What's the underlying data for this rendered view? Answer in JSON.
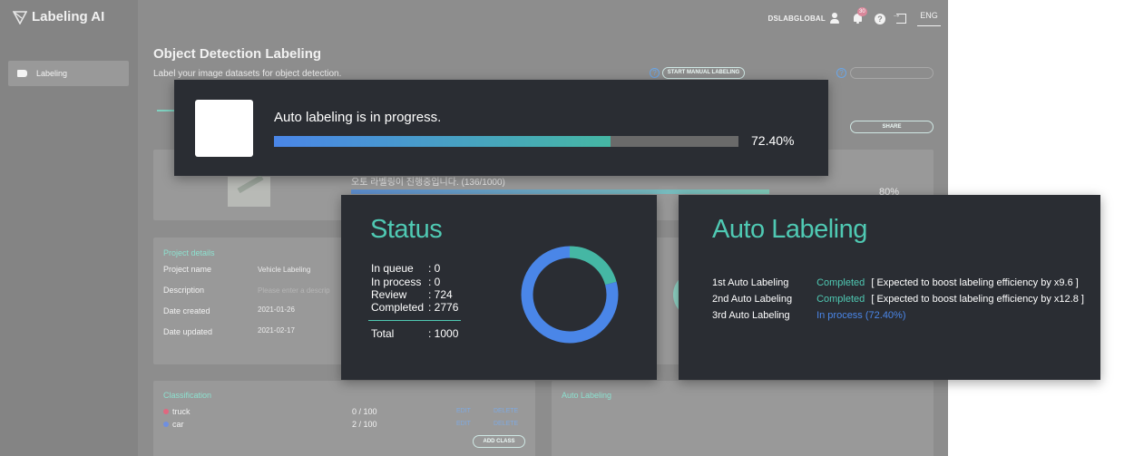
{
  "app": {
    "logo_text": "Labeling AI",
    "sidebar": {
      "items": [
        {
          "label": "Labeling",
          "icon": "tag-icon",
          "active": true
        }
      ]
    },
    "topbar": {
      "user": "DSLABGLOBAL",
      "notification_count": "30",
      "language": "ENG"
    }
  },
  "page": {
    "title": "Object Detection Labeling",
    "subtitle": "Label your image datasets for object detection.",
    "start_manual_label": "START MANUAL LABELING",
    "share_label": "SHARE",
    "bg_progress_text": "오토 라벨링이 진행중입니다. (136/1000)",
    "bg_progress_pct": "80%",
    "details": {
      "title": "Project details",
      "rows": [
        {
          "label": "Project name",
          "value": "Vehicle Labeling"
        },
        {
          "label": "Description",
          "value": "Please enter a descrip"
        },
        {
          "label": "Date created",
          "value": "2021-01-26"
        },
        {
          "label": "Date updated",
          "value": "2021-02-17"
        }
      ]
    },
    "classification": {
      "title": "Classification",
      "classes": [
        {
          "name": "truck",
          "count": "0 / 100",
          "color": "#e0677f"
        },
        {
          "name": "car",
          "count": "2 / 100",
          "color": "#6f8fe0"
        }
      ],
      "edit_label": "EDIT",
      "delete_label": "DELETE",
      "add_class_label": "ADD CLASS"
    },
    "auto_labeling_section_title": "Auto Labeling"
  },
  "progress_overlay": {
    "message": "Auto labeling is in progress.",
    "percent_text": "72.40%",
    "percent": 72.4
  },
  "status_panel": {
    "title": "Status",
    "rows": [
      {
        "label": "In queue",
        "value": ": 0"
      },
      {
        "label": "In process",
        "value": ": 0"
      },
      {
        "label": "Review",
        "value": ": 724"
      },
      {
        "label": "Completed",
        "value": ": 2776"
      }
    ],
    "total": {
      "label": "Total",
      "value": ": 1000"
    },
    "donut": {
      "segments": [
        {
          "name": "Review",
          "value": 724,
          "color": "#45b7a4"
        },
        {
          "name": "Completed",
          "value": 2776,
          "color": "#4a86e8"
        }
      ]
    }
  },
  "auto_panel": {
    "title": "Auto Labeling",
    "rows": [
      {
        "name": "1st Auto Labeling",
        "status": "Completed",
        "note": "[ Expected to boost labeling efficiency by x9.6 ]",
        "state": "done"
      },
      {
        "name": "2nd Auto Labeling",
        "status": "Completed",
        "note": "[ Expected to boost labeling efficiency by x12.8 ]",
        "state": "done"
      },
      {
        "name": "3rd Auto Labeling",
        "status": "In process (72.40%)",
        "note": "",
        "state": "progress"
      }
    ]
  },
  "colors": {
    "accent_teal": "#4fc9b3",
    "accent_blue": "#4a86e8",
    "panel_bg": "#2a2d33"
  }
}
